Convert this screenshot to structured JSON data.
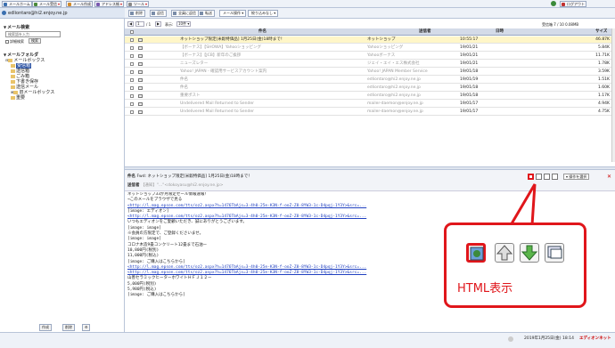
{
  "toolbar": {
    "buttons": [
      {
        "label": "メールホーム"
      },
      {
        "label": "メール受信"
      },
      {
        "label": "メール作成"
      },
      {
        "label": "アドレス帳"
      },
      {
        "label": "ツール"
      }
    ],
    "help_label": "ログアウト"
  },
  "user": {
    "email": "edliontaro@hi2.enjoy.ne.jp"
  },
  "mainbar": {
    "buttons": [
      {
        "label": "削除"
      },
      {
        "label": "返信"
      },
      {
        "label": "全員に返信"
      },
      {
        "label": "転送"
      },
      {
        "label": "メール操作"
      },
      {
        "label": "絞り込みなし"
      }
    ]
  },
  "sidebar": {
    "search_title": "メール検索",
    "search_placeholder": "検索語を入力",
    "detail_label": "詳細検索",
    "search_button": "検索",
    "folder_title": "メールフォルダ",
    "folders": [
      {
        "label": "メールボックス"
      },
      {
        "label": "受信箱"
      },
      {
        "label": "送信箱"
      },
      {
        "label": "ごみ箱"
      },
      {
        "label": "下書き保存"
      },
      {
        "label": "送信メール"
      },
      {
        "label": "旧メールボックス"
      },
      {
        "label": "重要"
      }
    ],
    "footer": [
      "作成",
      "削除"
    ]
  },
  "list": {
    "page": "1",
    "page_total": "/ 1",
    "per_page_label": "表示:",
    "per_page": "10件",
    "folder_stats": "受信箱 7 / 10 0.08MB",
    "columns": [
      "件名",
      "送信者",
      "日時",
      "サイズ"
    ],
    "rows": [
      {
        "subject": "ネットショップ限定[米穀特価品] 1月25日(金)18時まで！",
        "sender": "ネットショップ",
        "date": "10:55:17",
        "size": "46.87K",
        "selected": true
      },
      {
        "subject": "【ボーナス】【SHOWA】Yahooショッピング",
        "sender": "Yahooショッピング",
        "date": "19/01/21",
        "size": "5.84K"
      },
      {
        "subject": "【ボーナス】【JCB】新年のご挨拶",
        "sender": "Yahooボーナス",
        "date": "19/01/21",
        "size": "11.71K"
      },
      {
        "subject": "ニューズレター",
        "sender": "ジェイ・エイ・エス株式会社",
        "date": "19/01/21",
        "size": "1.78K"
      },
      {
        "subject": "Yahoo! JAPAN - 確認用サービスアカウント案内",
        "sender": "Yahoo! JAPAN Member Service",
        "date": "19/01/18",
        "size": "3.59K"
      },
      {
        "subject": "件名",
        "sender": "edliontaro@hi2.enjoy.ne.jp",
        "date": "19/01/19",
        "size": "1.51K"
      },
      {
        "subject": "件名",
        "sender": "edliontaro@hi2.enjoy.ne.jp",
        "date": "19/01/18",
        "size": "1.60K"
      },
      {
        "subject": "重要ポスト",
        "sender": "edliontaro@hi2.enjoy.ne.jp",
        "date": "19/01/18",
        "size": "1.17K"
      },
      {
        "subject": "Undelivered Mail Returned to Sender",
        "sender": "mailer-daemon@enjoy.ne.jp",
        "date": "19/01/17",
        "size": "4.94K"
      },
      {
        "subject": "Undelivered Mail Returned to Sender",
        "sender": "mailer-daemon@enjoy.ne.jp",
        "date": "19/01/17",
        "size": "4.75K"
      }
    ]
  },
  "message": {
    "subject_label": "件名",
    "subject": "Fwd: ネットショップ限定[米穀特価品] 1月25日(金)18時まで！",
    "from_label": "送信者",
    "from": "【通知】\"...\"<dokoyasu@hi2.enjoy.ne.jp>",
    "action_label": "操作を選択",
    "body": [
      "ネットショップ33か月限定セール情報速報！",
      "→このメールをブラウザで見る",
      "<http://l.mag.epson.com/tts/oz2.aspx?h=1476TbAjs=3-4h0-25e-K3N-f-ooZ-Z8-8YW3-1c-D4pqj-1Y3Y>&src=...",
      "",
      "[image: エディオン]",
      "<http://l.mag.epson.com/tts/oz2.aspx?h=1476TbAjs=3-4h0-25e-K3N-f-ooZ-Z8-8YW3-1c-D4pqj-1Y3Y>&src=...",
      "いつもエディオンをご愛顧いただき、誠にありがとうございます。",
      "",
      "[image: image]",
      "",
      "※会員の方限定で、ご登録くださいませ。",
      "[image: image]",
      "",
      "コロナ木造9畳コンクリート12畳まで石油ー",
      "",
      "10,800円(税別)",
      "11,000円(税込)",
      "",
      "[image: ご購入はこちらから]",
      "<http://l.mag.epson.com/tts/oz2.aspx?h=1476TbAjs=3-4h0-25e-K3N-f-ooZ-Z8-8YW3-1c-D4pqj-1Y3Y>&src=...",
      "<http://l.mag.epson.com/tts/oz2.aspx?h=1476TbAjs=3-4h0-25e-K3N-f-ooZ-Z8-8YW3-1c-D4pqj-1Y3Y>&src=...",
      "",
      "山善セラミックヒーターホワイトＨＦＪ１２ー",
      "",
      "5,000円(税別)",
      "5,980円(税込)",
      "",
      "[image: ご購入はこちらから]"
    ]
  },
  "callout": {
    "label": "HTML表示"
  },
  "status": {
    "datetime": "2019年1月25日(金) 18:14",
    "brand": "エディオンネット"
  },
  "colors": {
    "accent": "#2f56a6",
    "callout": "#e0161b",
    "selected_row": "#fff6c8"
  }
}
